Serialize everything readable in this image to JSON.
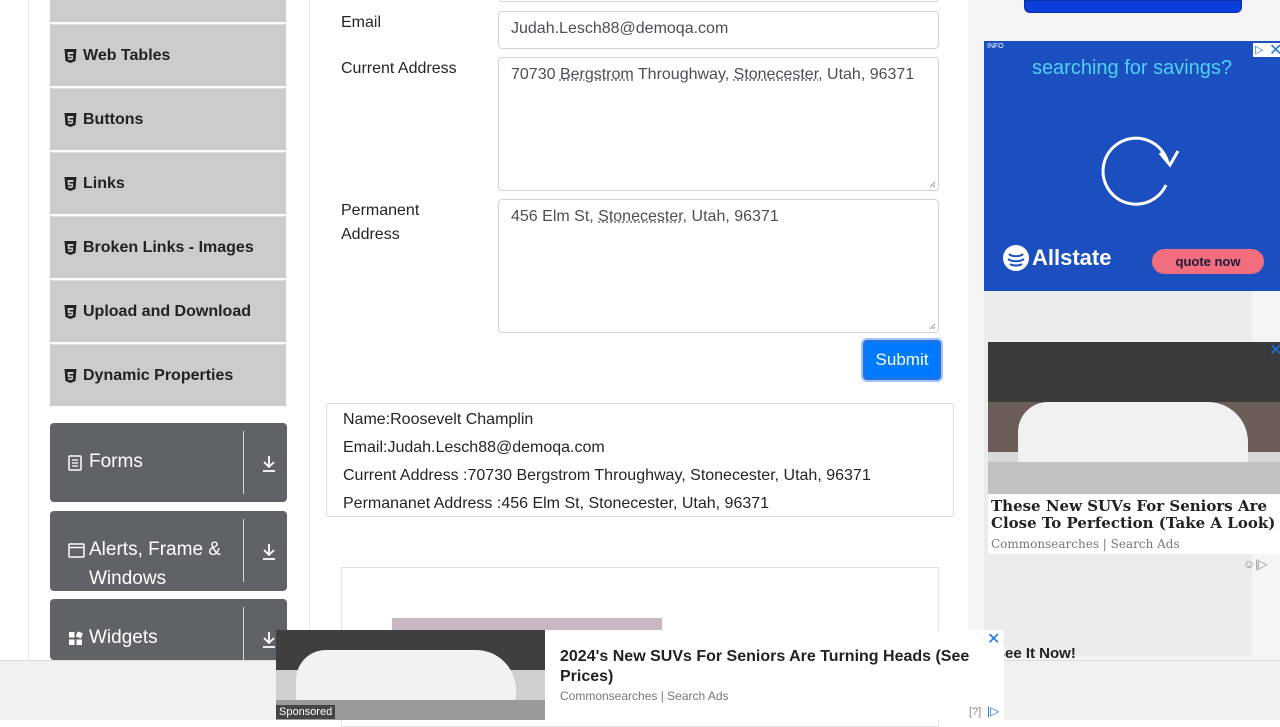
{
  "sidebar": {
    "items": [
      {
        "label": "Web Tables"
      },
      {
        "label": "Buttons"
      },
      {
        "label": "Links"
      },
      {
        "label": "Broken Links - Images"
      },
      {
        "label": "Upload and Download"
      },
      {
        "label": "Dynamic Properties"
      }
    ],
    "groups": [
      {
        "label": "Forms"
      },
      {
        "label": "Alerts, Frame & Windows"
      },
      {
        "label": "Widgets"
      }
    ]
  },
  "form": {
    "email_label": "Email",
    "email_value": "Judah.Lesch88@demoqa.com",
    "current_address_label": "Current Address",
    "current_address": {
      "p1": "70730 ",
      "w1": "Bergstrom",
      "p2": " Throughway, ",
      "w2": "Stonecester",
      "p3": ", Utah, 96371"
    },
    "permanent_address_label": "Permanent Address",
    "permanent_address": {
      "p1": "456 Elm St, ",
      "w1": "Stonecester",
      "p2": ", Utah, 96371"
    },
    "submit_label": "Submit"
  },
  "output": {
    "name": "Name:Roosevelt Champlin",
    "email": "Email:Judah.Lesch88@demoqa.com",
    "current": "Current Address :70730 Bergstrom Throughway, Stonecester, Utah, 96371",
    "permanent": "Permananet Address :456 Elm St, Stonecester, Utah, 96371"
  },
  "ads": {
    "allstate": {
      "info": "INFO",
      "headline": "searching for savings?",
      "brand": "Allstate",
      "cta": "quote now"
    },
    "suv_side": {
      "title": "These New SUVs For Seniors Are Close To Perfection (Take A Look)",
      "source": "Commonsearches | Search Ads",
      "see_it": "See It Now!"
    },
    "bottom": {
      "title": "2024's New SUVs For Seniors Are Turning Heads (See Prices)",
      "source": "Commonsearches | Search Ads",
      "sponsored": "Sponsored",
      "help": "[?]"
    }
  },
  "colors": {
    "primary": "#007bff",
    "group_bg": "#5f6368",
    "item_bg": "#cccccc",
    "allstate_bg": "#1b4fbf"
  }
}
